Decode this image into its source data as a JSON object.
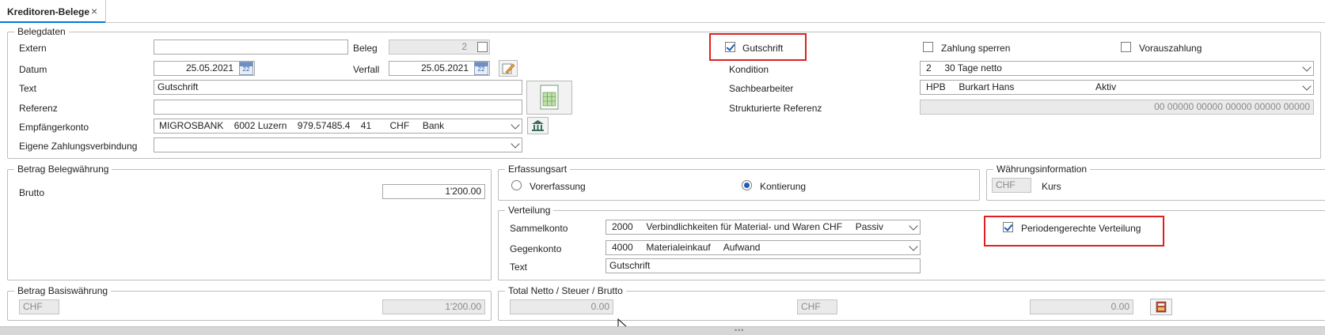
{
  "tab": {
    "label": "Kreditoren-Belege",
    "close": "×"
  },
  "belegdaten": {
    "title": "Belegdaten",
    "extern_label": "Extern",
    "extern_value": "",
    "beleg_label": "Beleg",
    "beleg_value": "2",
    "datum_label": "Datum",
    "datum_value": "25.05.2021",
    "verfall_label": "Verfall",
    "verfall_value": "25.05.2021",
    "text_label": "Text",
    "text_value": "Gutschrift",
    "referenz_label": "Referenz",
    "referenz_value": "",
    "empfaenger_label": "Empfängerkonto",
    "empfaenger_value": "MIGROSBANK    6002 Luzern    979.57485.4    41       CHF     Bank",
    "eigene_label": "Eigene Zahlungsverbindung",
    "eigene_value": "",
    "gutschrift_label": "Gutschrift",
    "gutschrift_checked": true,
    "zahlung_sperren_label": "Zahlung sperren",
    "zahlung_sperren_checked": false,
    "vorauszahlung_label": "Vorauszahlung",
    "vorauszahlung_checked": false,
    "kondition_label": "Kondition",
    "kondition_value": "2     30 Tage netto",
    "sachbearbeiter_label": "Sachbearbeiter",
    "sachbearbeiter_value": "HPB     Burkart Hans                               Aktiv",
    "strukt_label": "Strukturierte Referenz",
    "strukt_value": "00 00000 00000 00000 00000 00000"
  },
  "betrag_beleg": {
    "title": "Betrag Belegwährung",
    "brutto_label": "Brutto",
    "brutto_value": "1'200.00"
  },
  "erfassungsart": {
    "title": "Erfassungsart",
    "vorerfassung_label": "Vorerfassung",
    "vorerfassung_selected": false,
    "kontierung_label": "Kontierung",
    "kontierung_selected": true
  },
  "waehrung": {
    "title": "Währungsinformation",
    "currency": "CHF",
    "kurs_label": "Kurs"
  },
  "verteilung": {
    "title": "Verteilung",
    "sammelkonto_label": "Sammelkonto",
    "sammelkonto_value": "2000     Verbindlichkeiten für Material- und Waren CHF     Passiv",
    "gegenkonto_label": "Gegenkonto",
    "gegenkonto_value": "4000     Materialeinkauf     Aufwand",
    "text_label": "Text",
    "text_value": "Gutschrift",
    "perioden_label": "Periodengerechte Verteilung",
    "perioden_checked": true
  },
  "betrag_basis": {
    "title": "Betrag Basiswährung",
    "currency": "CHF",
    "value": "1'200.00"
  },
  "total": {
    "title": "Total Netto / Steuer / Brutto",
    "netto": "0.00",
    "currency": "CHF",
    "brutto": "0.00"
  },
  "colors": {
    "highlight": "#e02020",
    "accent": "#1a5fb4",
    "tab_underline": "#0078d7"
  }
}
